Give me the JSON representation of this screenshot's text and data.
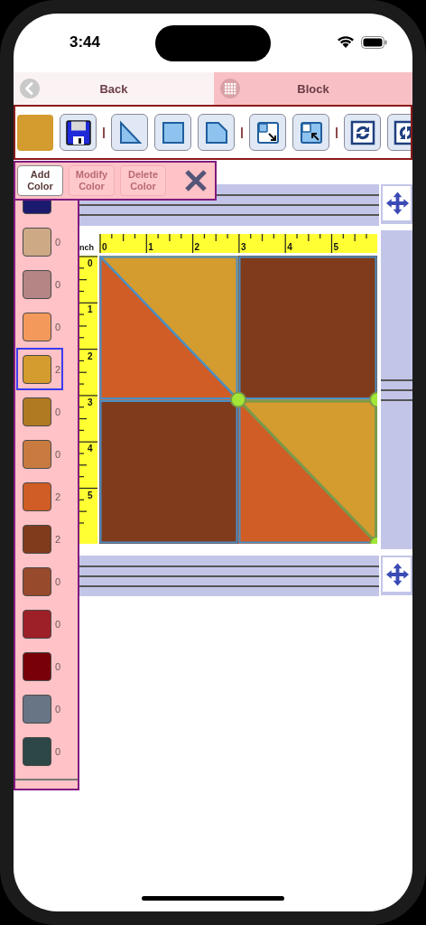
{
  "status_bar": {
    "time": "3:44"
  },
  "nav_bar": {
    "back_label": "Back",
    "title": "Block"
  },
  "toolbar": {
    "items": [
      {
        "kind": "save"
      },
      {
        "kind": "separator"
      },
      {
        "kind": "triangle"
      },
      {
        "kind": "square"
      },
      {
        "kind": "clipped-square"
      },
      {
        "kind": "separator"
      },
      {
        "kind": "send-back"
      },
      {
        "kind": "bring-front"
      },
      {
        "kind": "separator"
      },
      {
        "kind": "rotate"
      },
      {
        "kind": "flip"
      }
    ]
  },
  "color_panel": {
    "buttons": [
      {
        "label": "Add Color",
        "disabled": false
      },
      {
        "label": "Modify Color",
        "disabled": true
      },
      {
        "label": "Delete Color",
        "disabled": true
      }
    ],
    "colors": [
      {
        "color": "#1c1a6e",
        "selected": false
      },
      {
        "color": "#cdaa85",
        "count": "0",
        "selected": false
      },
      {
        "color": "#b58585",
        "count": "0",
        "selected": false
      },
      {
        "color": "#f4995c",
        "count": "0",
        "selected": false
      },
      {
        "color": "#d49b2e",
        "count": "2",
        "selected": true
      },
      {
        "color": "#b07a22",
        "count": "0",
        "selected": false
      },
      {
        "color": "#c87a40",
        "count": "0",
        "selected": false
      },
      {
        "color": "#cf5d25",
        "count": "2",
        "selected": false
      },
      {
        "color": "#7f3b1b",
        "count": "2",
        "selected": false
      },
      {
        "color": "#974a2c",
        "count": "0",
        "selected": false
      },
      {
        "color": "#9d1f27",
        "count": "0",
        "selected": false
      },
      {
        "color": "#780008",
        "count": "0",
        "selected": false
      },
      {
        "color": "#677585",
        "count": "0",
        "selected": false
      },
      {
        "color": "#2c4746",
        "count": "0",
        "selected": false
      }
    ]
  },
  "ruler": {
    "unit": "nch",
    "top_labels": [
      "0",
      "1",
      "2",
      "3",
      "4",
      "5"
    ],
    "left_labels": [
      "0",
      "1",
      "2",
      "3",
      "4",
      "5"
    ]
  },
  "block": {
    "pieces": [
      {
        "kind": "top-left-upper-triangle",
        "color": "#d49b2e",
        "selected": false
      },
      {
        "kind": "top-left-lower-triangle",
        "color": "#cf5d25",
        "selected": false
      },
      {
        "kind": "top-right-square",
        "color": "#7f3b1b",
        "selected": false
      },
      {
        "kind": "bottom-left-square",
        "color": "#7f3b1b",
        "selected": false
      },
      {
        "kind": "bottom-right-lower-triangle",
        "color": "#cf5d25",
        "selected": false
      },
      {
        "kind": "bottom-right-upper-triangle",
        "color": "#d49b2e",
        "selected": true
      }
    ]
  }
}
